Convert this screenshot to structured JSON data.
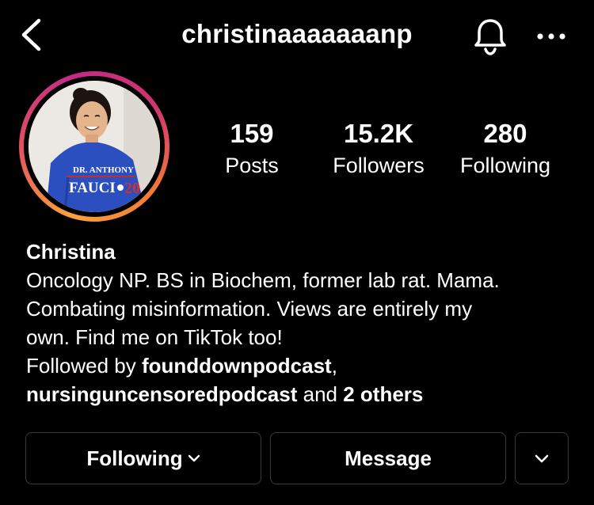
{
  "header": {
    "username": "christinaaaaaaanp",
    "back_icon": "chevron-left-icon",
    "notification_icon": "bell-icon",
    "more_icon": "ellipsis-icon"
  },
  "profile": {
    "avatar_shirt_line1": "DR. ANTHONY",
    "avatar_shirt_line2": "FAUCI",
    "avatar_shirt_line3": "20",
    "ring_colors": [
      "#f9a23a",
      "#e14e63",
      "#c02b86"
    ]
  },
  "stats": {
    "posts": {
      "value": "159",
      "label": "Posts"
    },
    "followers": {
      "value": "15.2K",
      "label": "Followers"
    },
    "following": {
      "value": "280",
      "label": "Following"
    }
  },
  "bio": {
    "name": "Christina",
    "line1": "Oncology NP. BS in Biochem, former lab rat. Mama.",
    "line2": "Combating misinformation. Views are entirely my",
    "line3": "own. Find me on TikTok too!",
    "followed_by_prefix": "Followed by ",
    "followed_by_user1": "founddownpodcast",
    "separator": ",",
    "followed_by_user2": "nursinguncensoredpodcast",
    "and_text": " and ",
    "others": "2 others"
  },
  "actions": {
    "following_label": "Following",
    "message_label": "Message",
    "more_icon": "chevron-down-icon"
  }
}
